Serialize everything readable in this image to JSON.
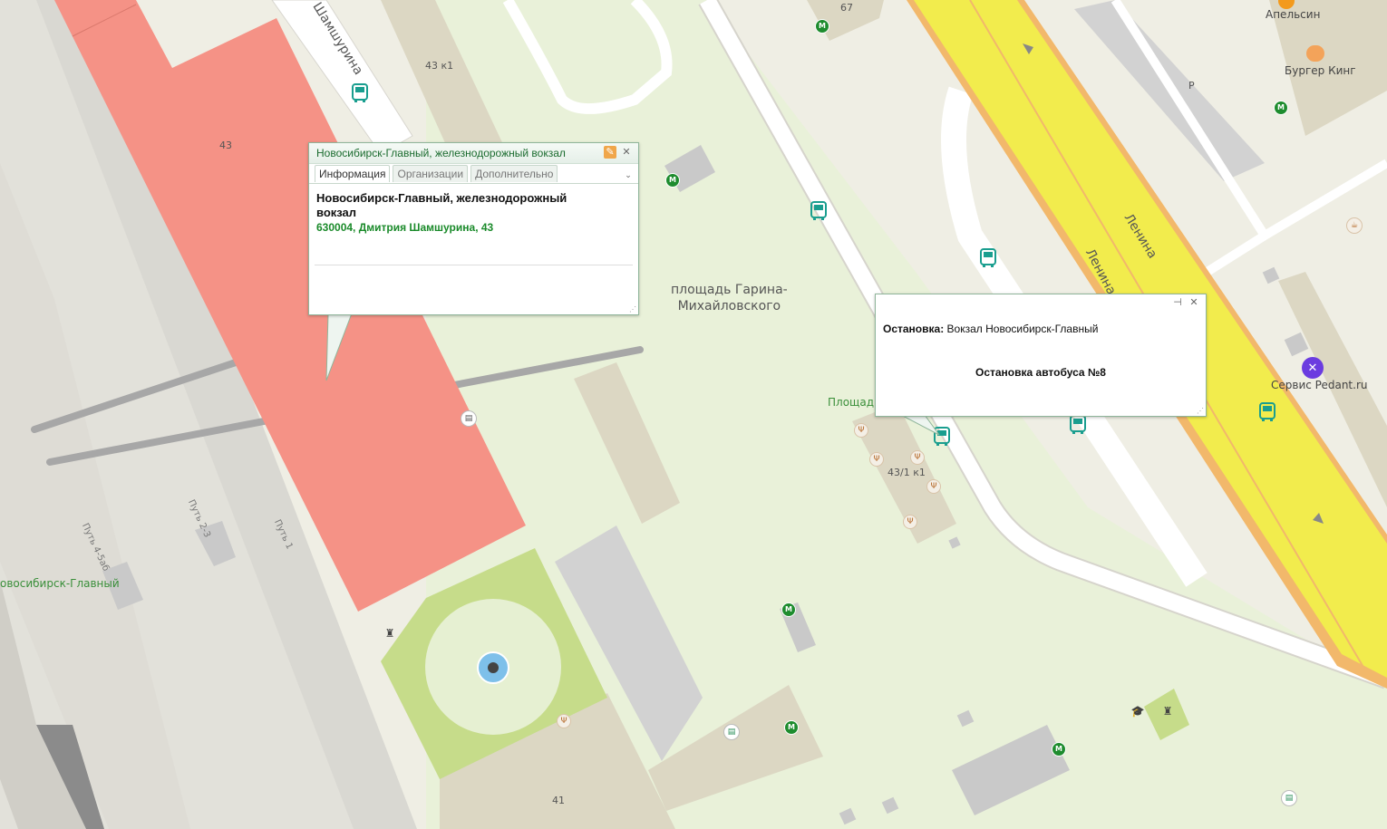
{
  "map": {
    "street_labels": {
      "shamshurina": "Шамшурина",
      "lenina_1": "Ленина",
      "lenina_2": "Ленина"
    },
    "building_numbers": {
      "b43": "43",
      "b43k1": "43 к1",
      "b67": "67",
      "b431k1": "43/1 к1",
      "b41": "41"
    },
    "square_label": "площадь Гарина-\nМихайловского",
    "square_label_partial": "Площадь",
    "station_label_partial": "овосибирск-Главный",
    "track_labels": {
      "t1": "Путь 1",
      "t23": "Путь 2-3",
      "t456": "Путь 4-5аб"
    },
    "poi_labels": {
      "apelsin": "Апельсин",
      "burger_king": "Бургер Кинг",
      "service_pedant": "Сервис Pedant.ru",
      "parking": "P"
    },
    "colors": {
      "railway_station": "#f59286",
      "road_main": "#f2ec4d",
      "road_border": "#f2b86b",
      "park": "#c6dc8a",
      "square": "#e6f0d2",
      "metro": "#1e8c2e",
      "bus": "#1a9e8f"
    },
    "icons": {
      "bus_stop": "bus-icon",
      "metro": "metro-icon",
      "restaurant": "fork-knife-icon",
      "fountain": "fountain-icon"
    }
  },
  "popup_station": {
    "title": "Новосибирск-Главный, железнодорожный вокзал",
    "tabs": [
      "Информация",
      "Организации",
      "Дополнительно"
    ],
    "active_tab": "Информация",
    "name": "Новосибирск-Главный, железнодорожный вокзал",
    "address": "630004, Дмитрия Шамшурина, 43"
  },
  "popup_stop": {
    "label": "Остановка:",
    "value": "Вокзал Новосибирск-Главный",
    "description": "Остановка автобуса №8"
  }
}
